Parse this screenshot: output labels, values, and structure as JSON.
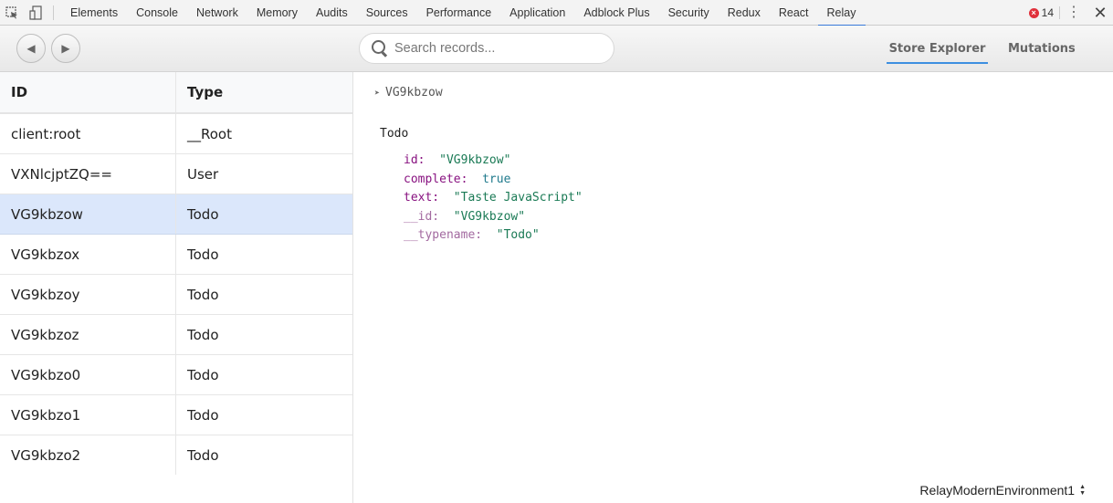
{
  "devtools": {
    "tabs": [
      "Elements",
      "Console",
      "Network",
      "Memory",
      "Audits",
      "Sources",
      "Performance",
      "Application",
      "Adblock Plus",
      "Security",
      "Redux",
      "React",
      "Relay"
    ],
    "active_tab": "Relay",
    "error_count": "14",
    "error_glyph": "×",
    "kebab_glyph": "⋮",
    "close_glyph": "✕"
  },
  "toolbar": {
    "back_glyph": "◀",
    "forward_glyph": "▶",
    "search_placeholder": "Search records...",
    "search_value": "",
    "views": [
      {
        "label": "Store Explorer",
        "active": true
      },
      {
        "label": "Mutations",
        "active": false
      }
    ]
  },
  "records": {
    "columns": [
      "ID",
      "Type"
    ],
    "rows": [
      {
        "id": "client:root",
        "type": "__Root",
        "selected": false
      },
      {
        "id": "VXNlcjptZQ==",
        "type": "User",
        "selected": false
      },
      {
        "id": "VG9kbzow",
        "type": "Todo",
        "selected": true
      },
      {
        "id": "VG9kbzox",
        "type": "Todo",
        "selected": false
      },
      {
        "id": "VG9kbzoy",
        "type": "Todo",
        "selected": false
      },
      {
        "id": "VG9kbzoz",
        "type": "Todo",
        "selected": false
      },
      {
        "id": "VG9kbzo0",
        "type": "Todo",
        "selected": false
      },
      {
        "id": "VG9kbzo1",
        "type": "Todo",
        "selected": false
      },
      {
        "id": "VG9kbzo2",
        "type": "Todo",
        "selected": false
      }
    ]
  },
  "detail": {
    "breadcrumb_arrow": "➤",
    "breadcrumb": "VG9kbzow",
    "type_name": "Todo",
    "fields": [
      {
        "key": "id:",
        "value": "\"VG9kbzow\"",
        "kind": "str",
        "meta": false
      },
      {
        "key": "complete:",
        "value": "true",
        "kind": "bool",
        "meta": false
      },
      {
        "key": "text:",
        "value": "\"Taste JavaScript\"",
        "kind": "str",
        "meta": false
      },
      {
        "key": "__id:",
        "value": "\"VG9kbzow\"",
        "kind": "str",
        "meta": true
      },
      {
        "key": "__typename:",
        "value": "\"Todo\"",
        "kind": "str",
        "meta": true
      }
    ]
  },
  "environment": {
    "selected": "RelayModernEnvironment1"
  },
  "colors": {
    "accent": "#3879d9",
    "selected_row": "#dbe7fb",
    "error": "#e0303b",
    "key": "#881280",
    "string": "#1a7a55"
  }
}
